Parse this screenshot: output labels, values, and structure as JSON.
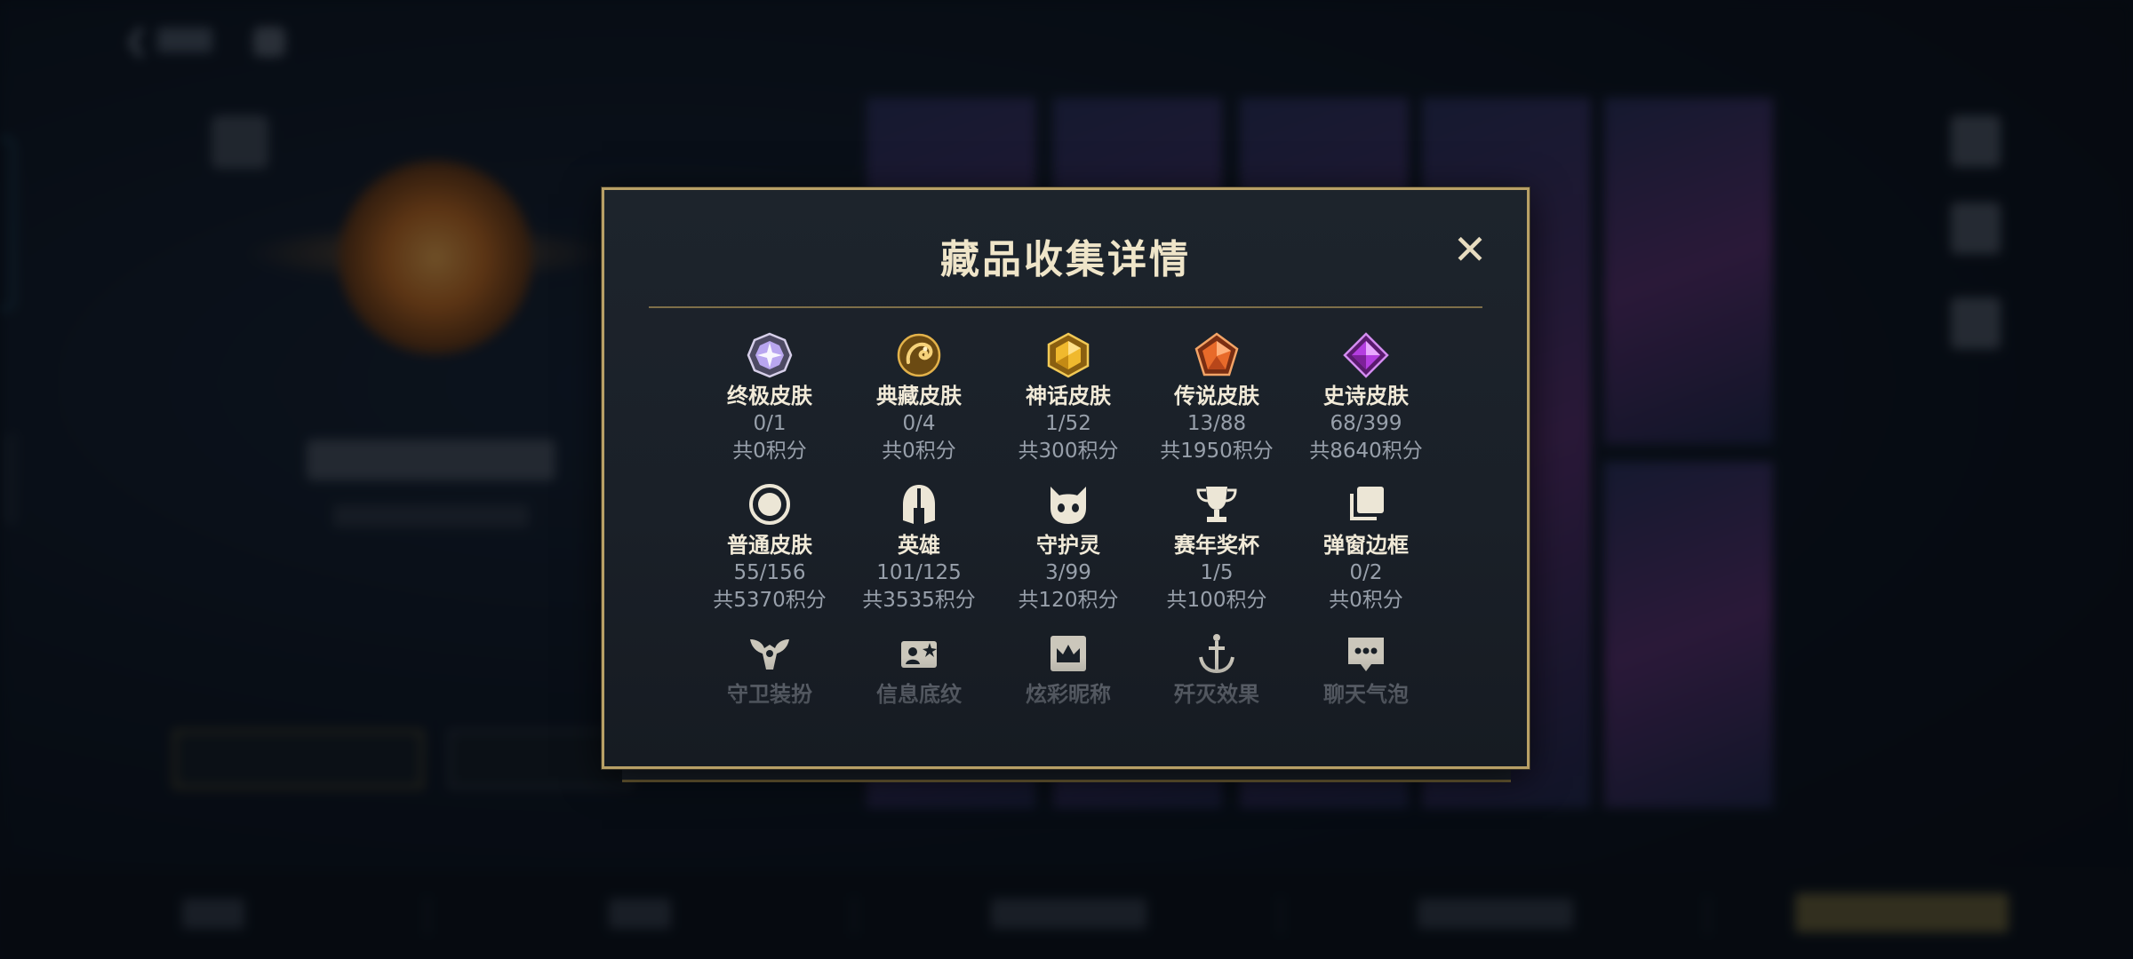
{
  "modal": {
    "title": "藏品收集详情",
    "close_label": "✕"
  },
  "collection_rows": [
    [
      {
        "name": "终极皮肤",
        "count": "0/1",
        "points": "共0积分",
        "icon": "ultimate-skin-icon"
      },
      {
        "name": "典藏皮肤",
        "count": "0/4",
        "points": "共0积分",
        "icon": "legacy-dragon-skin-icon"
      },
      {
        "name": "神话皮肤",
        "count": "1/52",
        "points": "共300积分",
        "icon": "mythic-skin-icon"
      },
      {
        "name": "传说皮肤",
        "count": "13/88",
        "points": "共1950积分",
        "icon": "legendary-skin-icon"
      },
      {
        "name": "史诗皮肤",
        "count": "68/399",
        "points": "共8640积分",
        "icon": "epic-skin-icon"
      }
    ],
    [
      {
        "name": "普通皮肤",
        "count": "55/156",
        "points": "共5370积分",
        "icon": "normal-skin-icon"
      },
      {
        "name": "英雄",
        "count": "101/125",
        "points": "共3535积分",
        "icon": "hero-helmet-icon"
      },
      {
        "name": "守护灵",
        "count": "3/99",
        "points": "共120积分",
        "icon": "guardian-spirit-icon"
      },
      {
        "name": "赛年奖杯",
        "count": "1/5",
        "points": "共100积分",
        "icon": "trophy-icon"
      },
      {
        "name": "弹窗边框",
        "count": "0/2",
        "points": "共0积分",
        "icon": "popup-frame-icon"
      }
    ],
    [
      {
        "name": "守卫装扮",
        "icon": "guard-outfit-icon"
      },
      {
        "name": "信息底纹",
        "icon": "info-card-icon"
      },
      {
        "name": "炫彩昵称",
        "icon": "nickname-crown-icon"
      },
      {
        "name": "歼灭效果",
        "icon": "kill-effect-icon"
      },
      {
        "name": "聊天气泡",
        "icon": "chat-bubble-icon"
      }
    ]
  ],
  "colors": {
    "frame_gold": "#b8a066",
    "title_text": "#efe5c9",
    "secondary_text": "#98a0ab"
  }
}
